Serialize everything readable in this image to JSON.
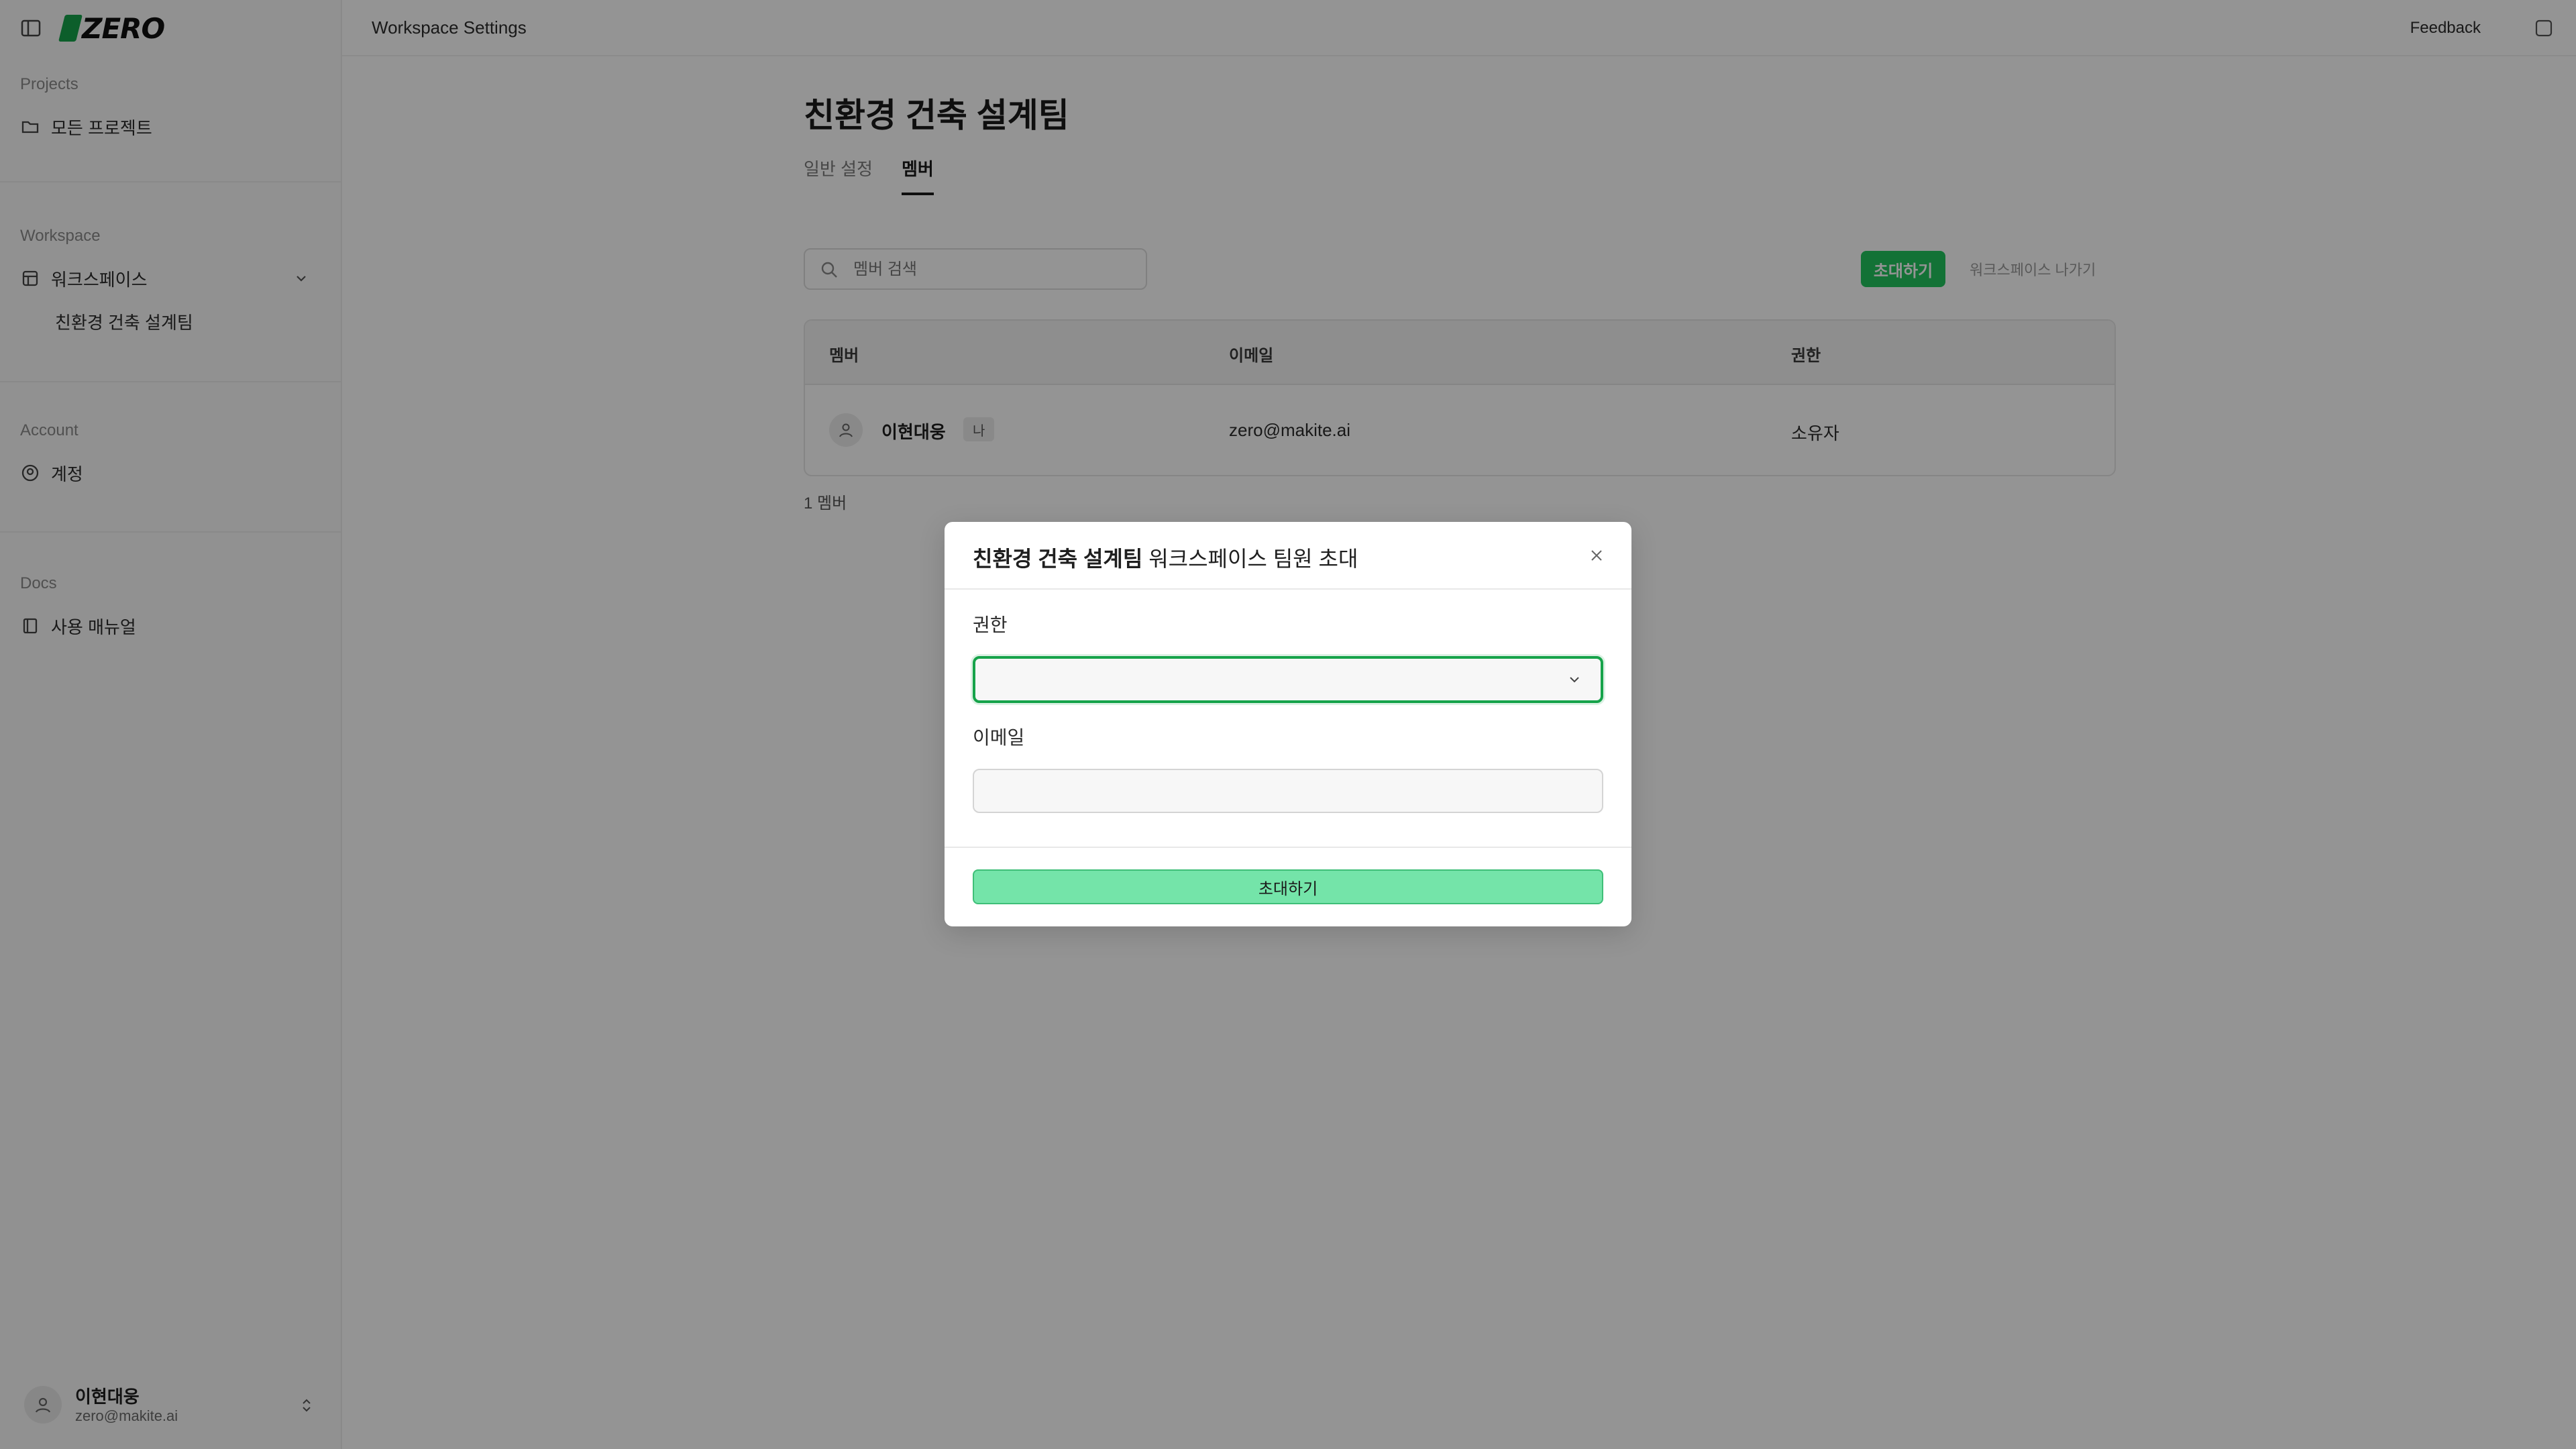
{
  "app": {
    "logo_text": "ZERO"
  },
  "sidebar": {
    "projects": {
      "title": "Projects",
      "items": [
        {
          "label": "모든 프로젝트",
          "icon": "folder-icon"
        }
      ]
    },
    "workspace": {
      "title": "Workspace",
      "item": {
        "label": "워크스페이스",
        "icon": "workspace-icon"
      },
      "sub_items": [
        {
          "label": "친환경 건축 설계팀"
        }
      ]
    },
    "account": {
      "title": "Account",
      "items": [
        {
          "label": "계정",
          "icon": "user-circle-icon"
        }
      ]
    },
    "docs": {
      "title": "Docs",
      "items": [
        {
          "label": "사용 매뉴얼",
          "icon": "book-icon"
        }
      ]
    },
    "user": {
      "name": "이현대웅",
      "email": "zero@makite.ai"
    }
  },
  "topbar": {
    "title": "Workspace Settings",
    "feedback_label": "Feedback"
  },
  "main": {
    "page_title": "친환경 건축 설계팀",
    "tabs": [
      {
        "label": "일반 설정",
        "active": false
      },
      {
        "label": "멤버",
        "active": true
      }
    ],
    "search_placeholder": "멤버 검색",
    "invite_label": "초대하기",
    "leave_label": "워크스페이스 나가기",
    "table": {
      "headers": [
        "멤버",
        "이메일",
        "권한"
      ],
      "rows": [
        {
          "name": "이현대웅",
          "badge": "나",
          "email": "zero@makite.ai",
          "role": "소유자"
        }
      ]
    },
    "member_count": "1 멤버"
  },
  "modal": {
    "title_strong": "친환경 건축 설계팀",
    "title_rest": " 워크스페이스 팀원 초대",
    "role_label": "권한",
    "role_value": "",
    "email_label": "이메일",
    "email_value": "",
    "email_placeholder": "",
    "submit_label": "초대하기"
  },
  "colors": {
    "accent": "#16a34a",
    "submit_bg": "#74e4a9",
    "overlay": "rgba(0,0,0,0.42)"
  }
}
